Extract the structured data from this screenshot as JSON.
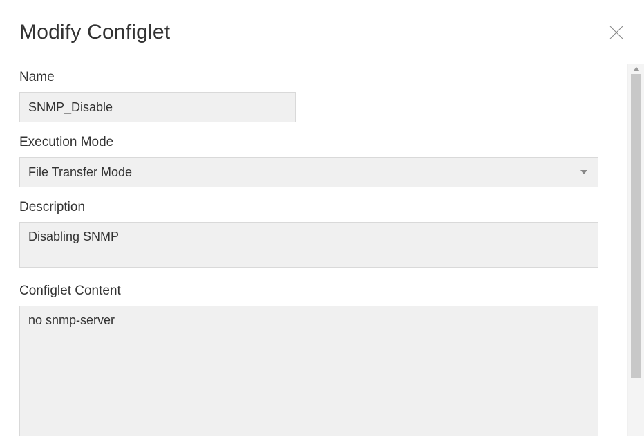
{
  "header": {
    "title": "Modify Configlet"
  },
  "fields": {
    "name": {
      "label": "Name",
      "value": "SNMP_Disable"
    },
    "execution_mode": {
      "label": "Execution Mode",
      "value": "File Transfer Mode"
    },
    "description": {
      "label": "Description",
      "value": "Disabling SNMP"
    },
    "configlet_content": {
      "label": "Configlet Content",
      "value": "no snmp-server"
    }
  }
}
